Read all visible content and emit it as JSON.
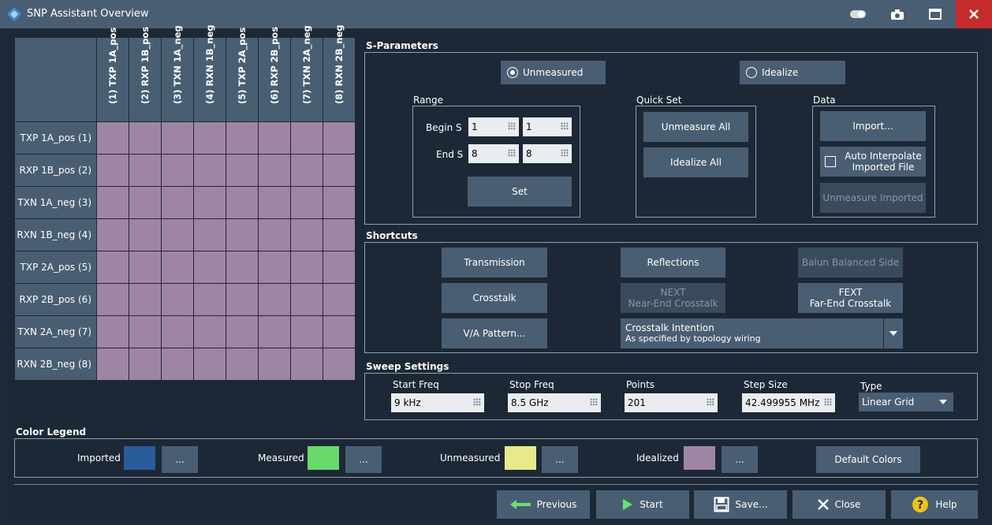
{
  "window": {
    "title": "SNP Assistant Overview"
  },
  "matrix": {
    "columns": [
      "(1)  TXP 1A_pos",
      "(2)  RXP 1B_pos",
      "(3)  TXN 1A_neg",
      "(4)  RXN 1B_neg",
      "(5)  TXP 2A_pos",
      "(6)  RXP 2B_pos",
      "(7)  TXN 2A_neg",
      "(8)  RXN 2B_neg"
    ],
    "rows": [
      "TXP 1A_pos (1)",
      "RXP 1B_pos (2)",
      "TXN 1A_neg (3)",
      "RXN 1B_neg (4)",
      "TXP 2A_pos (5)",
      "RXP 2B_pos (6)",
      "TXN 2A_neg (7)",
      "RXN 2B_neg (8)"
    ],
    "cell_state": "Idealized",
    "cell_color": "#9f85a4"
  },
  "sparams": {
    "title": "S-Parameters",
    "unmeasured": "Unmeasured",
    "idealize": "Idealize",
    "selected": "Unmeasured",
    "range_title": "Range",
    "begin_label": "Begin S",
    "end_label": "End S",
    "begin_1": "1",
    "begin_2": "1",
    "end_1": "8",
    "end_2": "8",
    "set": "Set",
    "quickset_title": "Quick Set",
    "unmeasure_all": "Unmeasure All",
    "idealize_all": "Idealize All",
    "data_title": "Data",
    "import": "Import...",
    "auto_interp_1": "Auto Interpolate",
    "auto_interp_2": "Imported File",
    "unmeasure_imported": "Unmeasure Imported"
  },
  "shortcuts": {
    "title": "Shortcuts",
    "transmission": "Transmission",
    "reflections": "Reflections",
    "balun": "Balun Balanced Side",
    "crosstalk": "Crosstalk",
    "next_1": "NEXT",
    "next_2": "Near-End Crosstalk",
    "fext_1": "FEXT",
    "fext_2": "Far-End Crosstalk",
    "va_pattern": "V/A Pattern...",
    "intention_1": "Crosstalk Intention",
    "intention_2": "As specified by topology wiring"
  },
  "sweep": {
    "title": "Sweep Settings",
    "start_label": "Start Freq",
    "start_value": "9 kHz",
    "stop_label": "Stop Freq",
    "stop_value": "8.5 GHz",
    "points_label": "Points",
    "points_value": "201",
    "step_label": "Step Size",
    "step_value": "42.499955 MHz",
    "type_label": "Type",
    "type_value": "Linear Grid"
  },
  "legend": {
    "title": "Color Legend",
    "imported": "Imported",
    "measured": "Measured",
    "unmeasured": "Unmeasured",
    "idealized": "Idealized",
    "more": "...",
    "default": "Default Colors",
    "colors": {
      "imported": "#2a5b9c",
      "measured": "#68d96a",
      "unmeasured": "#e6ea88",
      "idealized": "#9f85a4"
    }
  },
  "footer": {
    "previous": "Previous",
    "start": "Start",
    "save": "Save...",
    "close": "Close",
    "help": "Help"
  }
}
